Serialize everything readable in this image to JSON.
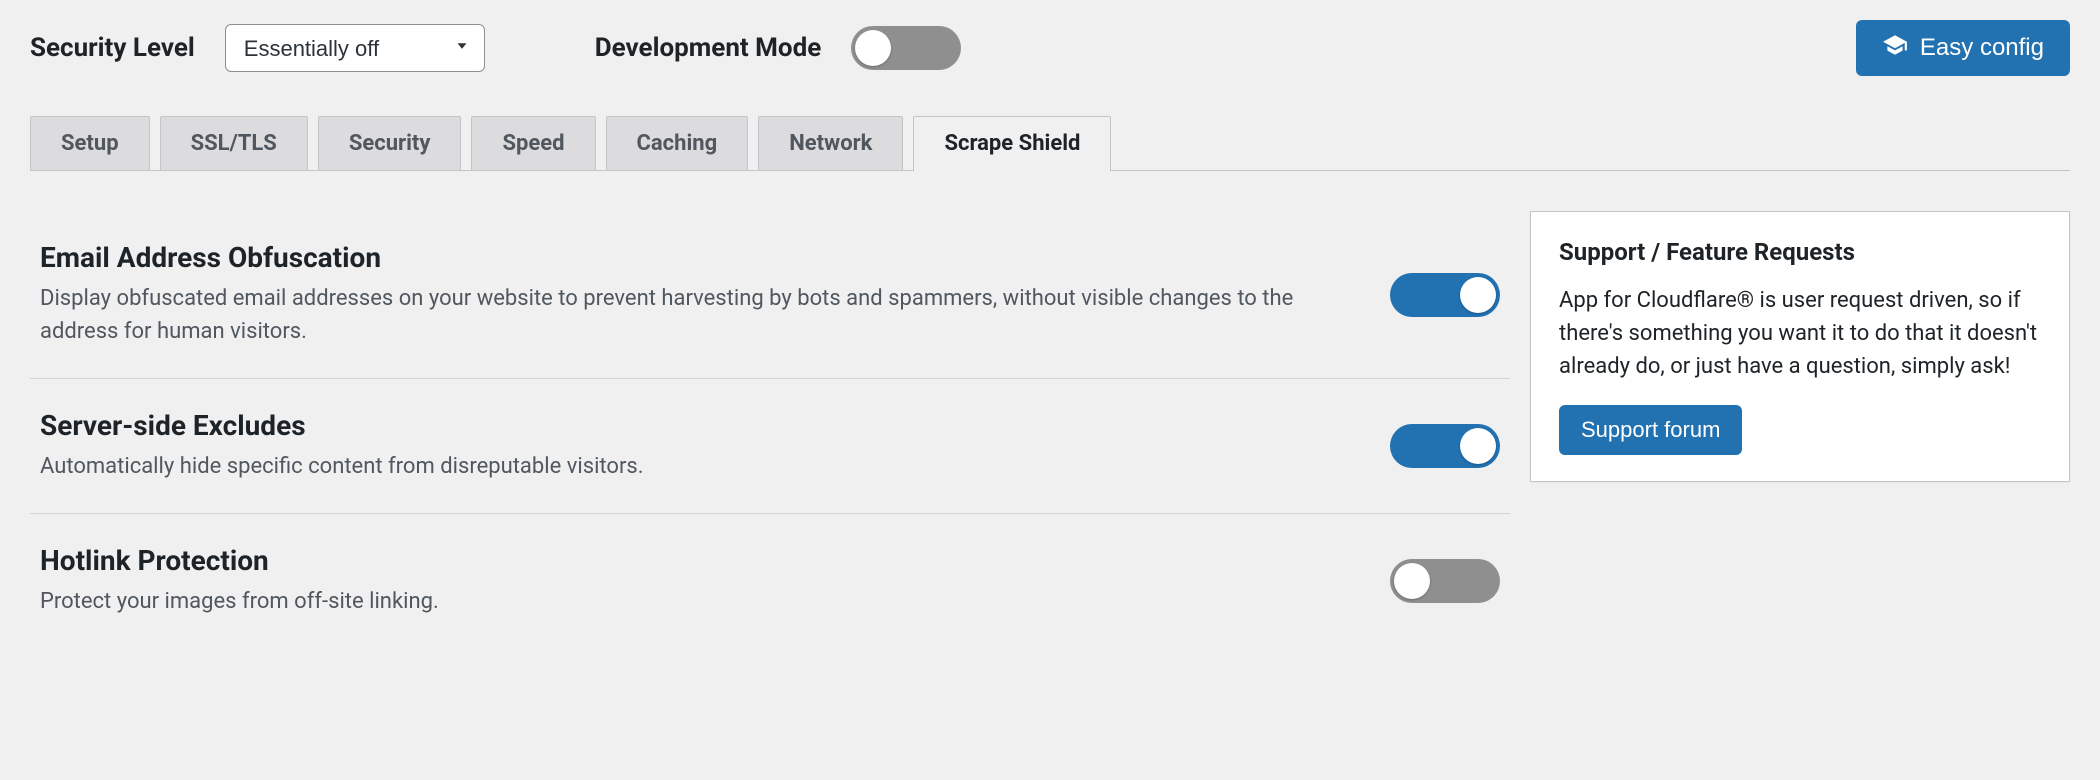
{
  "header": {
    "security_level_label": "Security Level",
    "security_level_value": "Essentially off",
    "development_mode_label": "Development Mode",
    "development_mode_on": false,
    "easy_config_label": "Easy config"
  },
  "tabs": [
    {
      "label": "Setup",
      "active": false
    },
    {
      "label": "SSL/TLS",
      "active": false
    },
    {
      "label": "Security",
      "active": false
    },
    {
      "label": "Speed",
      "active": false
    },
    {
      "label": "Caching",
      "active": false
    },
    {
      "label": "Network",
      "active": false
    },
    {
      "label": "Scrape Shield",
      "active": true
    }
  ],
  "settings": [
    {
      "title": "Email Address Obfuscation",
      "desc": "Display obfuscated email addresses on your website to prevent harvesting by bots and spammers, without visible changes to the address for human visitors.",
      "on": true
    },
    {
      "title": "Server-side Excludes",
      "desc": "Automatically hide specific content from disreputable visitors.",
      "on": true
    },
    {
      "title": "Hotlink Protection",
      "desc": "Protect your images from off-site linking.",
      "on": false
    }
  ],
  "sidebar": {
    "title": "Support / Feature Requests",
    "text": "App for Cloudflare® is user request driven, so if there's something you want it to do that it doesn't already do, or just have a question, simply ask!",
    "button_label": "Support forum"
  }
}
